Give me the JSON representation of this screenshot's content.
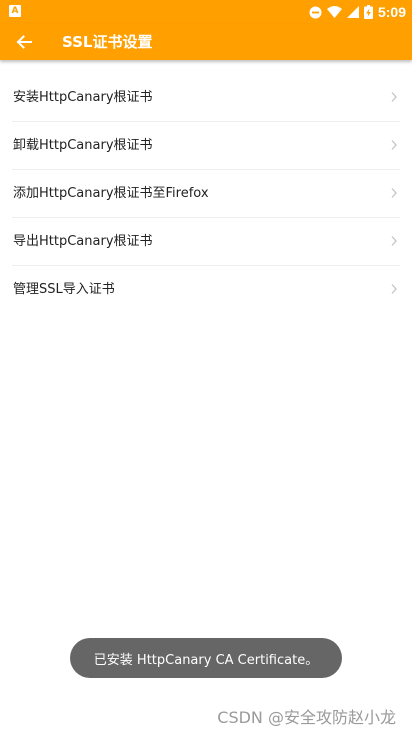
{
  "status_bar": {
    "left_icon": "a-app-icon",
    "left_icon_letter": "A",
    "icons": [
      "dnd-icon",
      "wifi-icon",
      "signal-icon",
      "battery-icon"
    ],
    "time": "5:09"
  },
  "app_bar": {
    "back_icon": "arrow-left-icon",
    "title": "SSL证书设置",
    "color": "#ffa000"
  },
  "list": {
    "items": [
      {
        "label": "安装HttpCanary根证书"
      },
      {
        "label": "卸载HttpCanary根证书"
      },
      {
        "label": "添加HttpCanary根证书至Firefox"
      },
      {
        "label": "导出HttpCanary根证书"
      },
      {
        "label": "管理SSL导入证书"
      }
    ],
    "chevron_icon": "chevron-right-icon"
  },
  "toast": {
    "text": "已安装 HttpCanary CA Certificate。"
  },
  "watermark": {
    "text": "CSDN @安全攻防赵小龙"
  }
}
